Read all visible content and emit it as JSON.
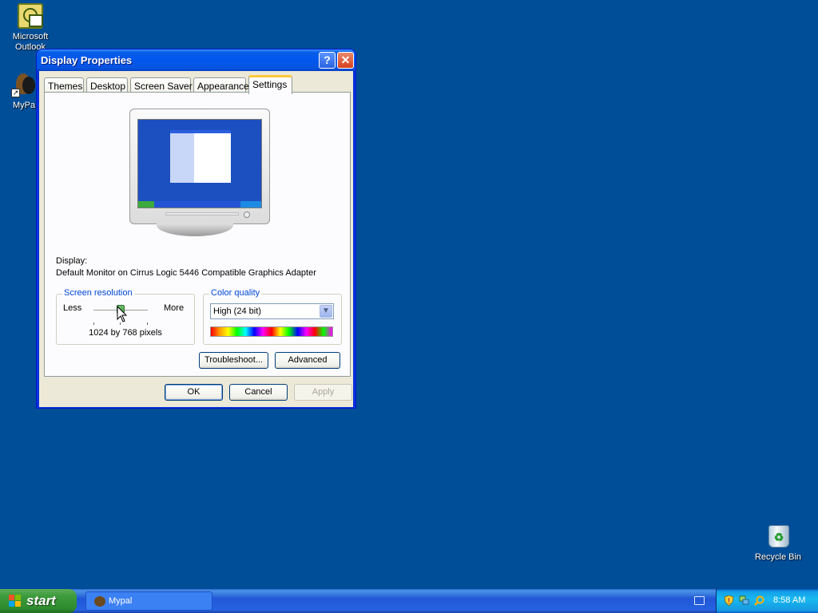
{
  "desktop": {
    "icons": [
      {
        "label": "Microsoft Outlook"
      },
      {
        "label": "MyPa"
      },
      {
        "label": "Recycle Bin"
      }
    ]
  },
  "window": {
    "title": "Display Properties",
    "help_glyph": "?",
    "close_glyph": "✕",
    "tabs": [
      {
        "label": "Themes"
      },
      {
        "label": "Desktop"
      },
      {
        "label": "Screen Saver"
      },
      {
        "label": "Appearance"
      },
      {
        "label": "Settings"
      }
    ],
    "active_tab": "Settings",
    "display_label": "Display:",
    "display_value": "Default Monitor on Cirrus Logic 5446 Compatible Graphics Adapter",
    "resolution": {
      "legend": "Screen resolution",
      "less": "Less",
      "more": "More",
      "value_text": "1024 by 768 pixels",
      "slider_position": 0.5
    },
    "color_quality": {
      "legend": "Color quality",
      "selected": "High (24 bit)"
    },
    "buttons": {
      "troubleshoot": "Troubleshoot...",
      "advanced": "Advanced",
      "ok": "OK",
      "cancel": "Cancel",
      "apply": "Apply"
    }
  },
  "taskbar": {
    "start_label": "start",
    "tasks": [
      {
        "label": "Mypal"
      }
    ],
    "clock": "8:58 AM"
  },
  "colors": {
    "desktop": "#004e98",
    "title_bar": "#0058ee",
    "start_green": "#3c9b3c",
    "tray_blue": "#18b9ef"
  }
}
